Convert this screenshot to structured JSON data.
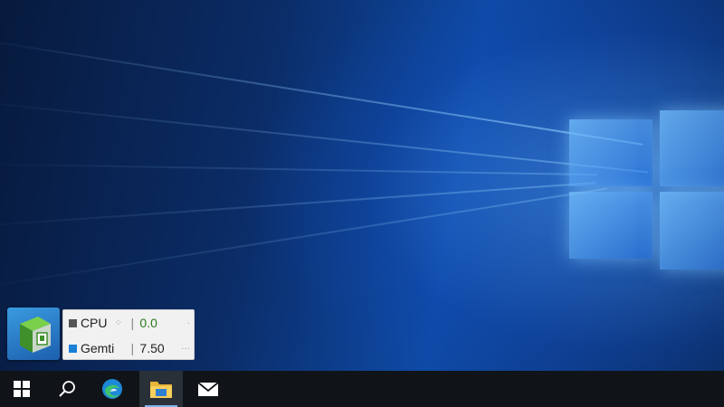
{
  "widget": {
    "icon": "widget-app-icon",
    "rows": [
      {
        "label": "CPU",
        "value": "0.0",
        "marker_color": "#555555",
        "value_color": "#2a7a1a"
      },
      {
        "label": "Gemti",
        "value": "7.50",
        "marker_color": "#1a7fd6",
        "value_color": "#222222"
      }
    ]
  },
  "taskbar": {
    "buttons": [
      {
        "name": "start-button",
        "icon": "windows-icon"
      },
      {
        "name": "search-button",
        "icon": "search-icon"
      },
      {
        "name": "edge-button",
        "icon": "edge-icon"
      },
      {
        "name": "file-explorer-button",
        "icon": "folder-icon",
        "active": true
      },
      {
        "name": "mail-button",
        "icon": "mail-icon"
      }
    ]
  },
  "colors": {
    "desktop_dark": "#071a3d",
    "desktop_accent": "#0e4aa6",
    "taskbar": "#101418",
    "widget_bg": "#f1f1f1"
  }
}
